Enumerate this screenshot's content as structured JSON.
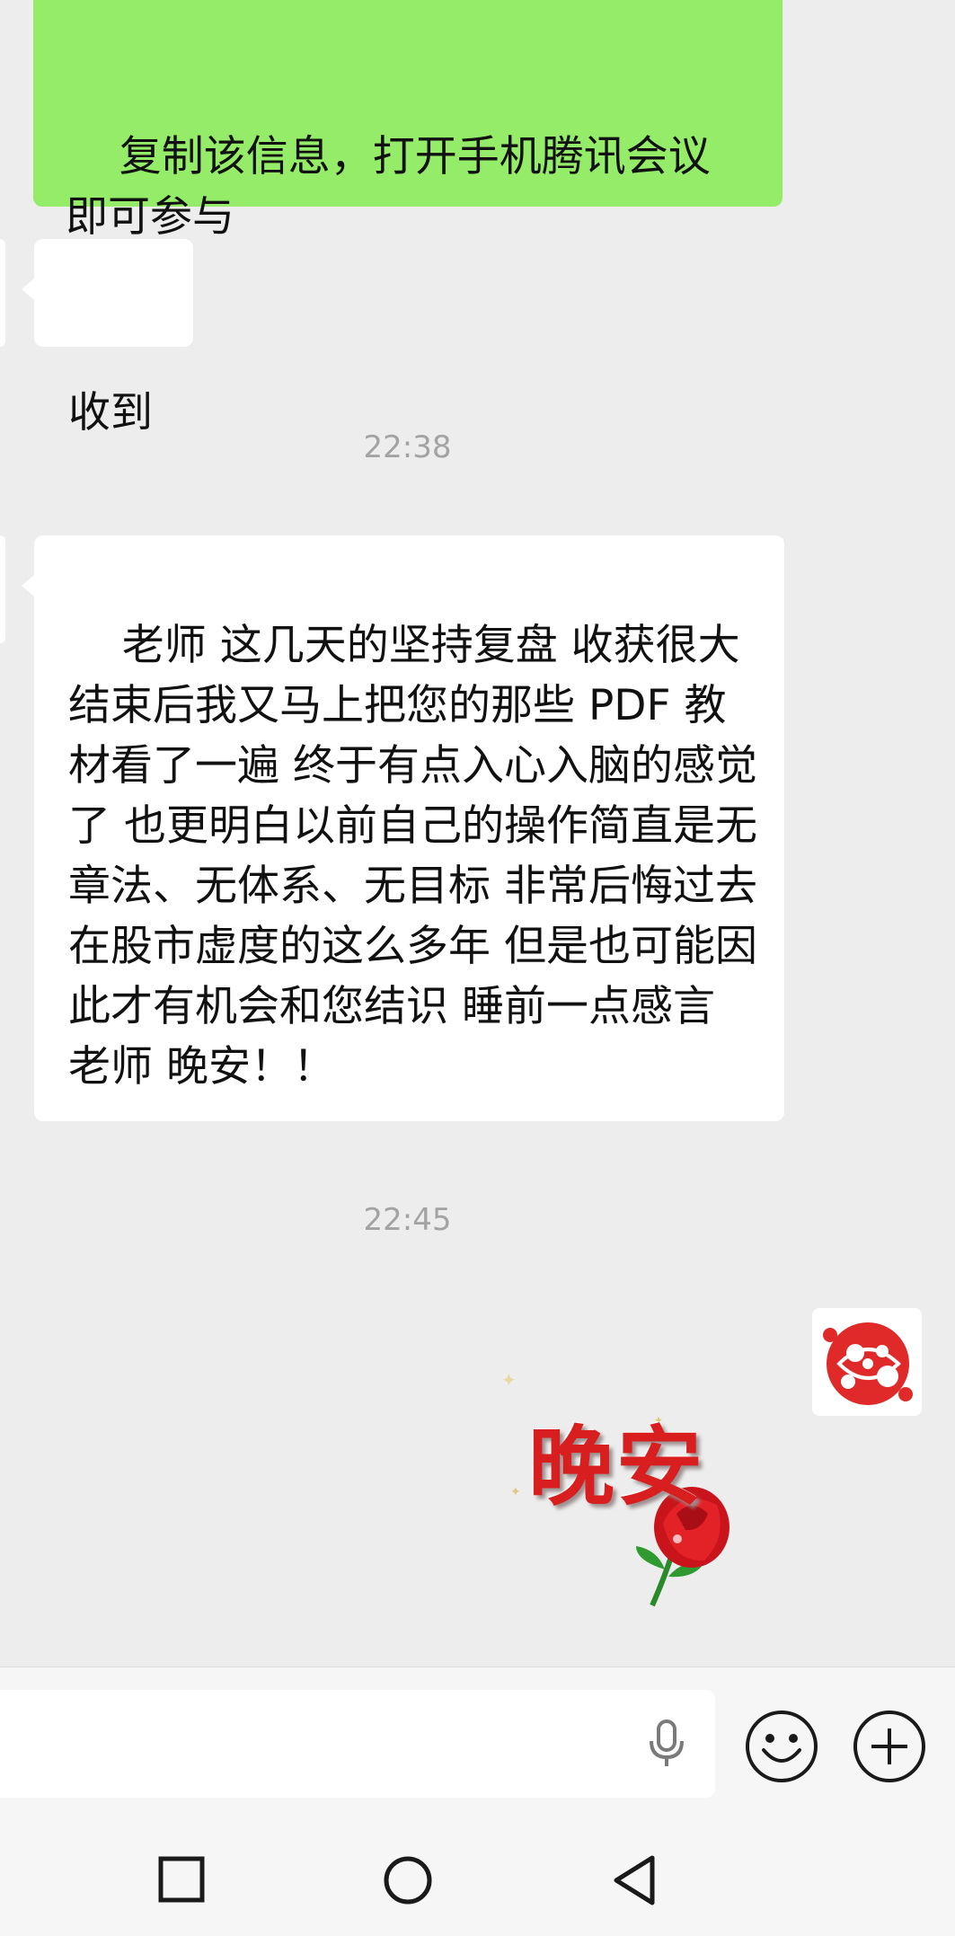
{
  "messages": {
    "sent_1": "复制该信息，打开手机腾讯会议即可参与",
    "received_1": "收到",
    "time_1": "22:38",
    "received_2": "老师 这几天的坚持复盘 收获很大 结束后我又马上把您的那些 PDF 教材看了一遍 终于有点入心入脑的感觉了 也更明白以前自己的操作简直是无章法、无体系、无目标 非常后悔过去在股市虚度的这么多年 但是也可能因此才有机会和您结识 睡前一点感言  老师 晚安！！",
    "time_2": "22:45",
    "sticker_text": "晚安"
  },
  "input_bar": {
    "placeholder": "",
    "icons": [
      "microphone-icon",
      "emoji-icon",
      "plus-icon"
    ]
  },
  "nav_bar": {
    "icons": [
      "recent-apps-icon",
      "home-icon",
      "back-icon"
    ]
  },
  "colors": {
    "sent_bubble": "#95ec69",
    "received_bubble": "#ffffff",
    "background": "#ededed",
    "timestamp": "#a3a3a3"
  }
}
